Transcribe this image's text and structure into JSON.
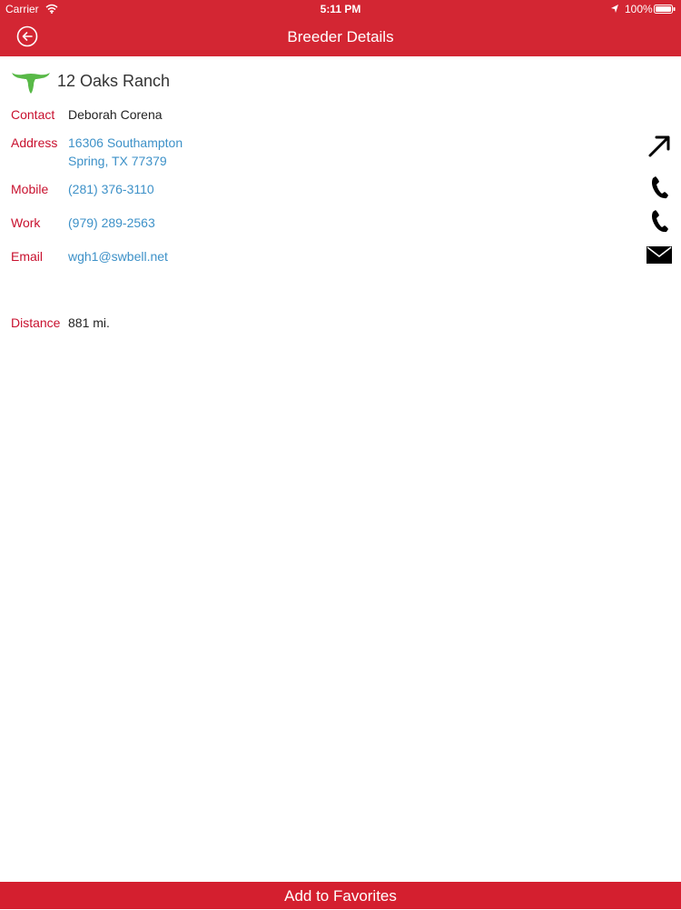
{
  "status_bar": {
    "carrier": "Carrier",
    "time": "5:11 PM",
    "battery": "100%"
  },
  "header": {
    "title": "Breeder Details",
    "back_icon": "circle-back-arrow-icon",
    "background_color": "#d32633"
  },
  "breeder": {
    "name": "12 Oaks Ranch",
    "logo_icon": "longhorn-icon",
    "logo_color": "#58b947"
  },
  "details": {
    "contact": {
      "label": "Contact",
      "value": "Deborah Corena"
    },
    "address": {
      "label": "Address",
      "line1": "16306 Southampton",
      "line2": "Spring, TX 77379",
      "action_icon": "directions-arrow-icon"
    },
    "mobile": {
      "label": "Mobile",
      "value": "(281) 376-3110",
      "action_icon": "phone-icon"
    },
    "work": {
      "label": "Work",
      "value": "(979) 289-2563",
      "action_icon": "phone-icon"
    },
    "email": {
      "label": "Email",
      "value": "wgh1@swbell.net",
      "action_icon": "mail-icon"
    },
    "distance": {
      "label": "Distance",
      "value": "881 mi."
    }
  },
  "footer": {
    "button_label": "Add to Favorites",
    "background_color": "#d41f2f"
  },
  "colors": {
    "accent_red": "#c8102e",
    "link_blue": "#3d91c8"
  }
}
